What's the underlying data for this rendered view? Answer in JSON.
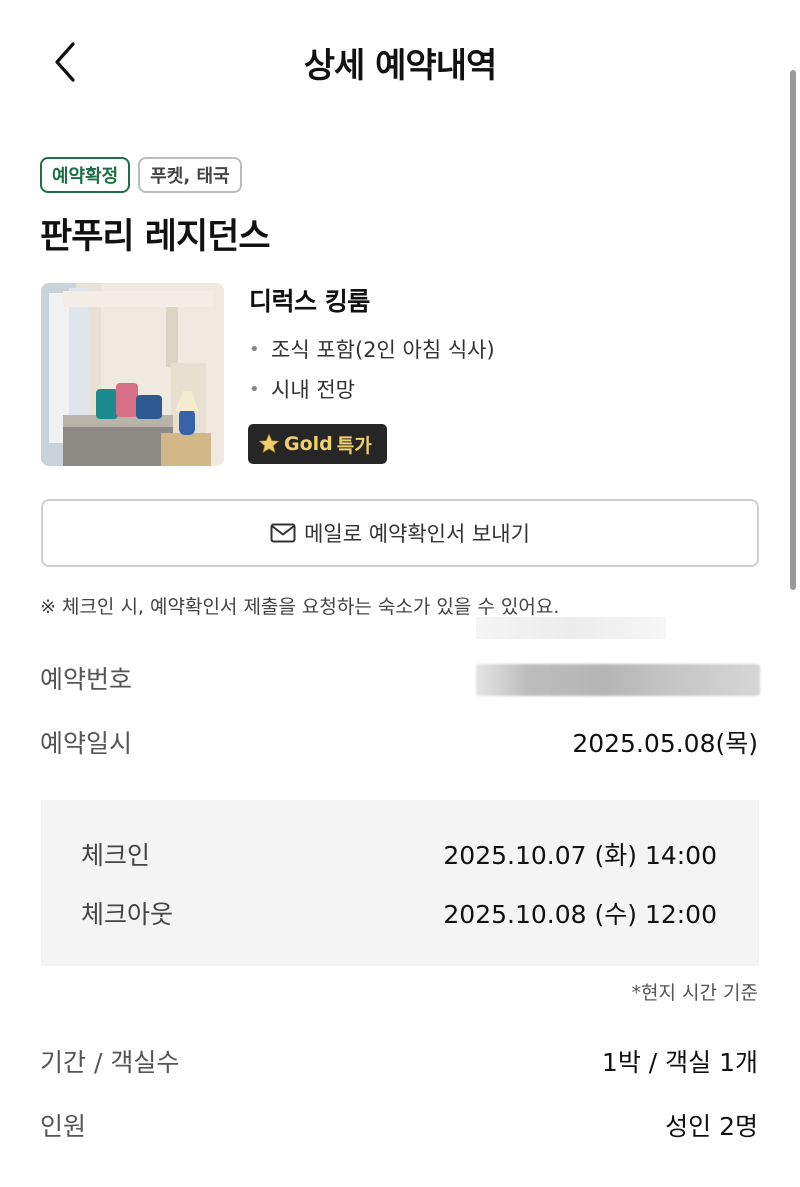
{
  "header": {
    "title": "상세 예약내역",
    "back_icon": "chevron-left-icon"
  },
  "badges": {
    "status": "예약확정",
    "location": "푸켓, 태국",
    "status_color": "#1f6e45"
  },
  "hotel": {
    "name": "판푸리 레지던스"
  },
  "room": {
    "name": "디럭스 킹룸",
    "features": [
      "조식 포함(2인 아침 식사)",
      "시내 전망"
    ],
    "promo": {
      "icon": "star-icon",
      "label_a": "Gold",
      "label_b": "특가",
      "color": "#f2cf6d"
    }
  },
  "email_button": {
    "label": "메일로 예약확인서 보내기",
    "icon": "envelope-icon"
  },
  "notice": "※ 체크인 시, 예약확인서 제출을 요청하는 숙소가 있을 수 있어요.",
  "booking": {
    "number_label": "예약번호",
    "date_label": "예약일시",
    "date_value": "2025.05.08(목)"
  },
  "stay": {
    "checkin_label": "체크인",
    "checkin_value": "2025.10.07 (화) 14:00",
    "checkout_label": "체크아웃",
    "checkout_value": "2025.10.08 (수) 12:00",
    "local_time_note": "*현지 시간 기준"
  },
  "summary": {
    "period_label": "기간 / 객실수",
    "period_value": "1박 / 객실 1개",
    "guests_label": "인원",
    "guests_value": "성인 2명"
  }
}
